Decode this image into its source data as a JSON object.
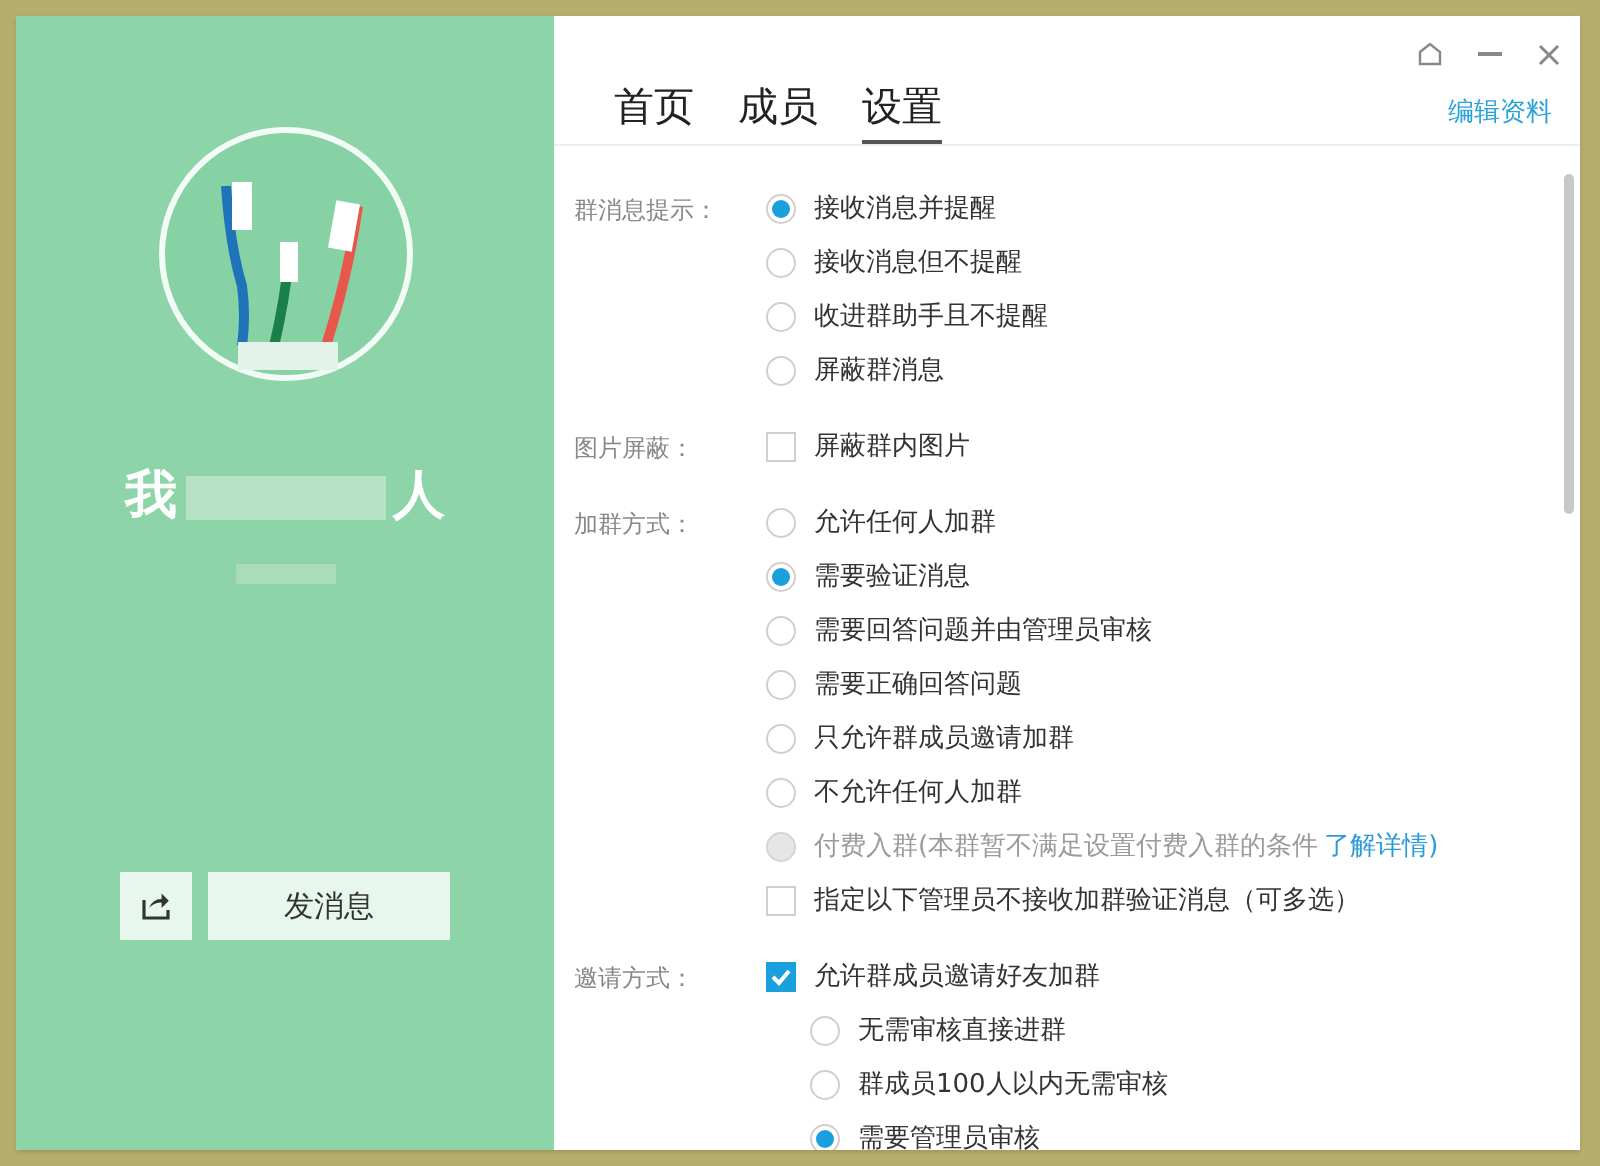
{
  "group": {
    "name_start": "我",
    "name_end": "人"
  },
  "actions": {
    "send": "发消息"
  },
  "tabs": [
    {
      "label": "首页",
      "selected": false
    },
    {
      "label": "成员",
      "selected": false
    },
    {
      "label": "设置",
      "selected": true
    }
  ],
  "edit_link": "编辑资料",
  "sections": [
    {
      "label": "群消息提示：",
      "options": [
        {
          "kind": "radio",
          "text": "接收消息并提醒",
          "selected": true,
          "disabled": false
        },
        {
          "kind": "radio",
          "text": "接收消息但不提醒",
          "selected": false,
          "disabled": false
        },
        {
          "kind": "radio",
          "text": "收进群助手且不提醒",
          "selected": false,
          "disabled": false
        },
        {
          "kind": "radio",
          "text": "屏蔽群消息",
          "selected": false,
          "disabled": false
        }
      ]
    },
    {
      "label": "图片屏蔽：",
      "options": [
        {
          "kind": "checkbox",
          "text": "屏蔽群内图片",
          "checked": false
        }
      ]
    },
    {
      "label": "加群方式：",
      "options": [
        {
          "kind": "radio",
          "text": "允许任何人加群",
          "selected": false,
          "disabled": false
        },
        {
          "kind": "radio",
          "text": "需要验证消息",
          "selected": true,
          "disabled": false
        },
        {
          "kind": "radio",
          "text": "需要回答问题并由管理员审核",
          "selected": false,
          "disabled": false
        },
        {
          "kind": "radio",
          "text": "需要正确回答问题",
          "selected": false,
          "disabled": false
        },
        {
          "kind": "radio",
          "text": "只允许群成员邀请加群",
          "selected": false,
          "disabled": false
        },
        {
          "kind": "radio",
          "text": "不允许任何人加群",
          "selected": false,
          "disabled": false
        },
        {
          "kind": "radio",
          "text": "付费入群(本群暂不满足设置付费入群的条件",
          "link": "了解详情)",
          "selected": false,
          "disabled": true
        },
        {
          "kind": "checkbox",
          "text": "指定以下管理员不接收加群验证消息（可多选）",
          "checked": false
        }
      ]
    },
    {
      "label": "邀请方式：",
      "options": [
        {
          "kind": "checkbox",
          "text": "允许群成员邀请好友加群",
          "checked": true,
          "children": [
            {
              "kind": "radio",
              "text": "无需审核直接进群",
              "selected": false,
              "disabled": false
            },
            {
              "kind": "radio",
              "text": "群成员100人以内无需审核",
              "selected": false,
              "disabled": false
            },
            {
              "kind": "radio",
              "text": "需要管理员审核",
              "selected": true,
              "disabled": false
            }
          ]
        }
      ]
    }
  ]
}
